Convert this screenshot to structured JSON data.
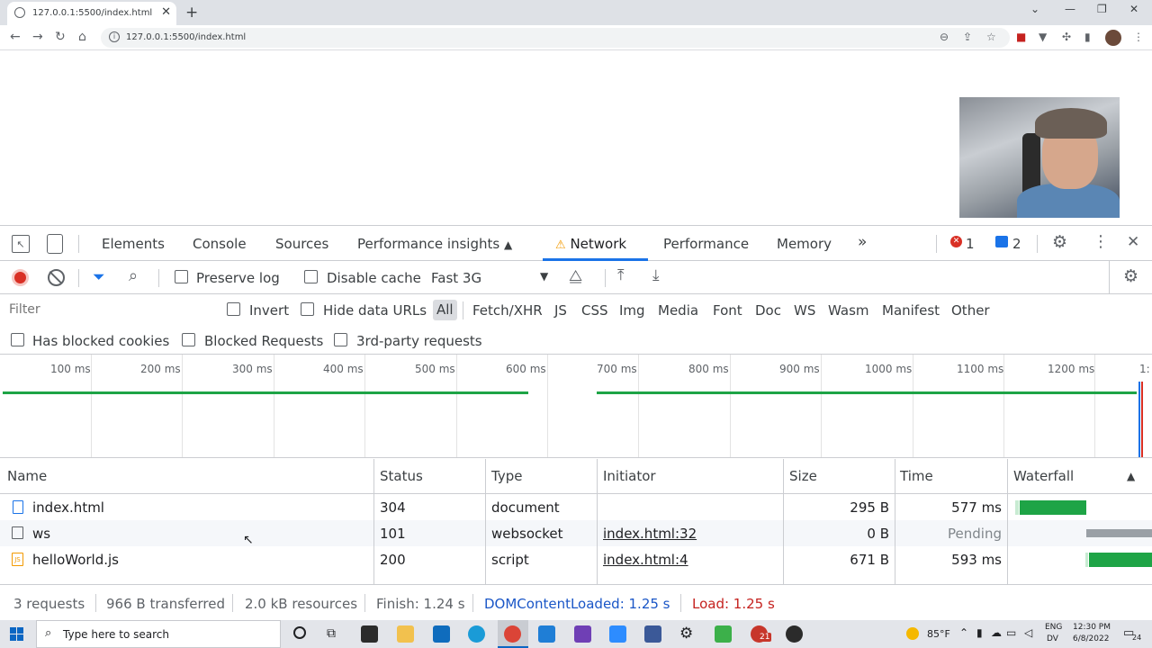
{
  "browser": {
    "tab_title": "127.0.0.1:5500/index.html",
    "url": "127.0.0.1:5500/index.html"
  },
  "devtools": {
    "tabs": [
      "Elements",
      "Console",
      "Sources",
      "Performance insights",
      "Network",
      "Performance",
      "Memory"
    ],
    "active_tab": "Network",
    "error_count": "1",
    "message_count": "2"
  },
  "toolbar": {
    "preserve_log": "Preserve log",
    "disable_cache": "Disable cache",
    "throttling": "Fast 3G"
  },
  "filter": {
    "placeholder": "Filter",
    "invert": "Invert",
    "hide_data_urls": "Hide data URLs",
    "types": [
      "All",
      "Fetch/XHR",
      "JS",
      "CSS",
      "Img",
      "Media",
      "Font",
      "Doc",
      "WS",
      "Wasm",
      "Manifest",
      "Other"
    ],
    "active_type": "All",
    "has_blocked_cookies": "Has blocked cookies",
    "blocked_requests": "Blocked Requests",
    "third_party": "3rd-party requests"
  },
  "overview": {
    "ticks": [
      "100 ms",
      "200 ms",
      "300 ms",
      "400 ms",
      "500 ms",
      "600 ms",
      "700 ms",
      "800 ms",
      "900 ms",
      "1000 ms",
      "1100 ms",
      "1200 ms",
      "1:"
    ]
  },
  "table": {
    "columns": [
      "Name",
      "Status",
      "Type",
      "Initiator",
      "Size",
      "Time",
      "Waterfall"
    ],
    "rows": [
      {
        "name": "index.html",
        "status": "304",
        "type": "document",
        "initiator": "",
        "size": "295 B",
        "time": "577 ms"
      },
      {
        "name": "ws",
        "status": "101",
        "type": "websocket",
        "initiator": "index.html:32",
        "size": "0 B",
        "time": "Pending"
      },
      {
        "name": "helloWorld.js",
        "status": "200",
        "type": "script",
        "initiator": "index.html:4",
        "size": "671 B",
        "time": "593 ms"
      }
    ]
  },
  "summary": {
    "requests": "3 requests",
    "transferred": "966 B transferred",
    "resources": "2.0 kB resources",
    "finish": "Finish: 1.24 s",
    "dom_content_loaded": "DOMContentLoaded: 1.25 s",
    "load": "Load: 1.25 s"
  },
  "taskbar": {
    "search_placeholder": "Type here to search",
    "weather": "85°F",
    "lang_top": "ENG",
    "lang_bottom": "DV",
    "time": "12:30 PM",
    "date": "6/8/2022",
    "notifications": "24",
    "badge_count": "21"
  },
  "colors": {
    "accent_blue": "#1a73e8",
    "record_red": "#d93025",
    "bar_green": "#1ea446",
    "dcl_blue": "#1a56c7",
    "load_red": "#c5221f"
  }
}
